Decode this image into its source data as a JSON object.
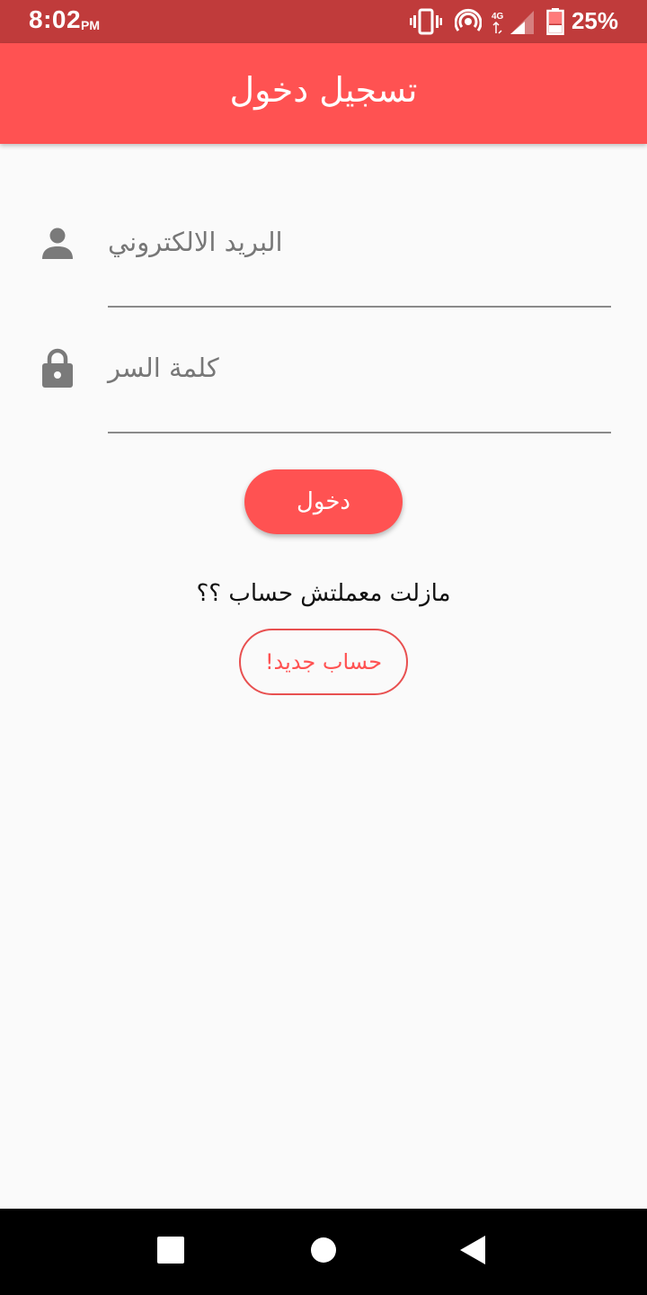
{
  "status_bar": {
    "time": "8:02",
    "ampm": "PM",
    "network": "4G",
    "battery": "25%"
  },
  "app_bar": {
    "title": "تسجيل دخول"
  },
  "form": {
    "email_placeholder": "البريد الالكتروني",
    "password_placeholder": "كلمة السر",
    "login_label": "دخول"
  },
  "signup": {
    "prompt": "مازلت معملتش حساب ؟؟",
    "button_label": "حساب جديد!"
  },
  "colors": {
    "status_bar": "#c03b3b",
    "accent": "#ff5252",
    "background": "#fafafa",
    "icon_grey": "#7a7a7a"
  },
  "icons": {
    "status": [
      "vibrate-icon",
      "hotspot-icon",
      "signal-icon",
      "battery-icon"
    ],
    "fields": [
      "person-icon",
      "lock-icon"
    ],
    "nav": [
      "recents-icon",
      "home-icon",
      "back-icon"
    ]
  }
}
